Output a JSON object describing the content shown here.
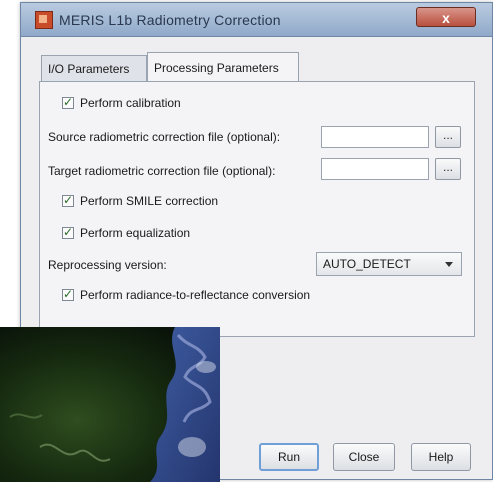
{
  "window": {
    "title": "MERIS L1b Radiometry Correction",
    "close_symbol": "x"
  },
  "tabs": [
    {
      "label": "I/O Parameters",
      "active": false
    },
    {
      "label": "Processing Parameters",
      "active": true
    }
  ],
  "form": {
    "perform_calibration": {
      "label": "Perform calibration",
      "checked": true
    },
    "source_file": {
      "label": "Source radiometric correction file (optional):",
      "value": "",
      "browse_label": "..."
    },
    "target_file": {
      "label": "Target radiometric correction file (optional):",
      "value": "",
      "browse_label": "..."
    },
    "perform_smile": {
      "label": "Perform SMILE correction",
      "checked": true
    },
    "perform_equalization": {
      "label": "Perform equalization",
      "checked": true
    },
    "reprocessing_version": {
      "label": "Reprocessing version:",
      "value": "AUTO_DETECT"
    },
    "perform_radiance": {
      "label": "Perform radiance-to-reflectance conversion",
      "checked": true
    }
  },
  "buttons": {
    "run": "Run",
    "close": "Close",
    "help": "Help"
  },
  "colors": {
    "titlebar": "#9fb5d1",
    "window_bg": "#eeeef0",
    "default_button_border": "#6f9fd6"
  }
}
